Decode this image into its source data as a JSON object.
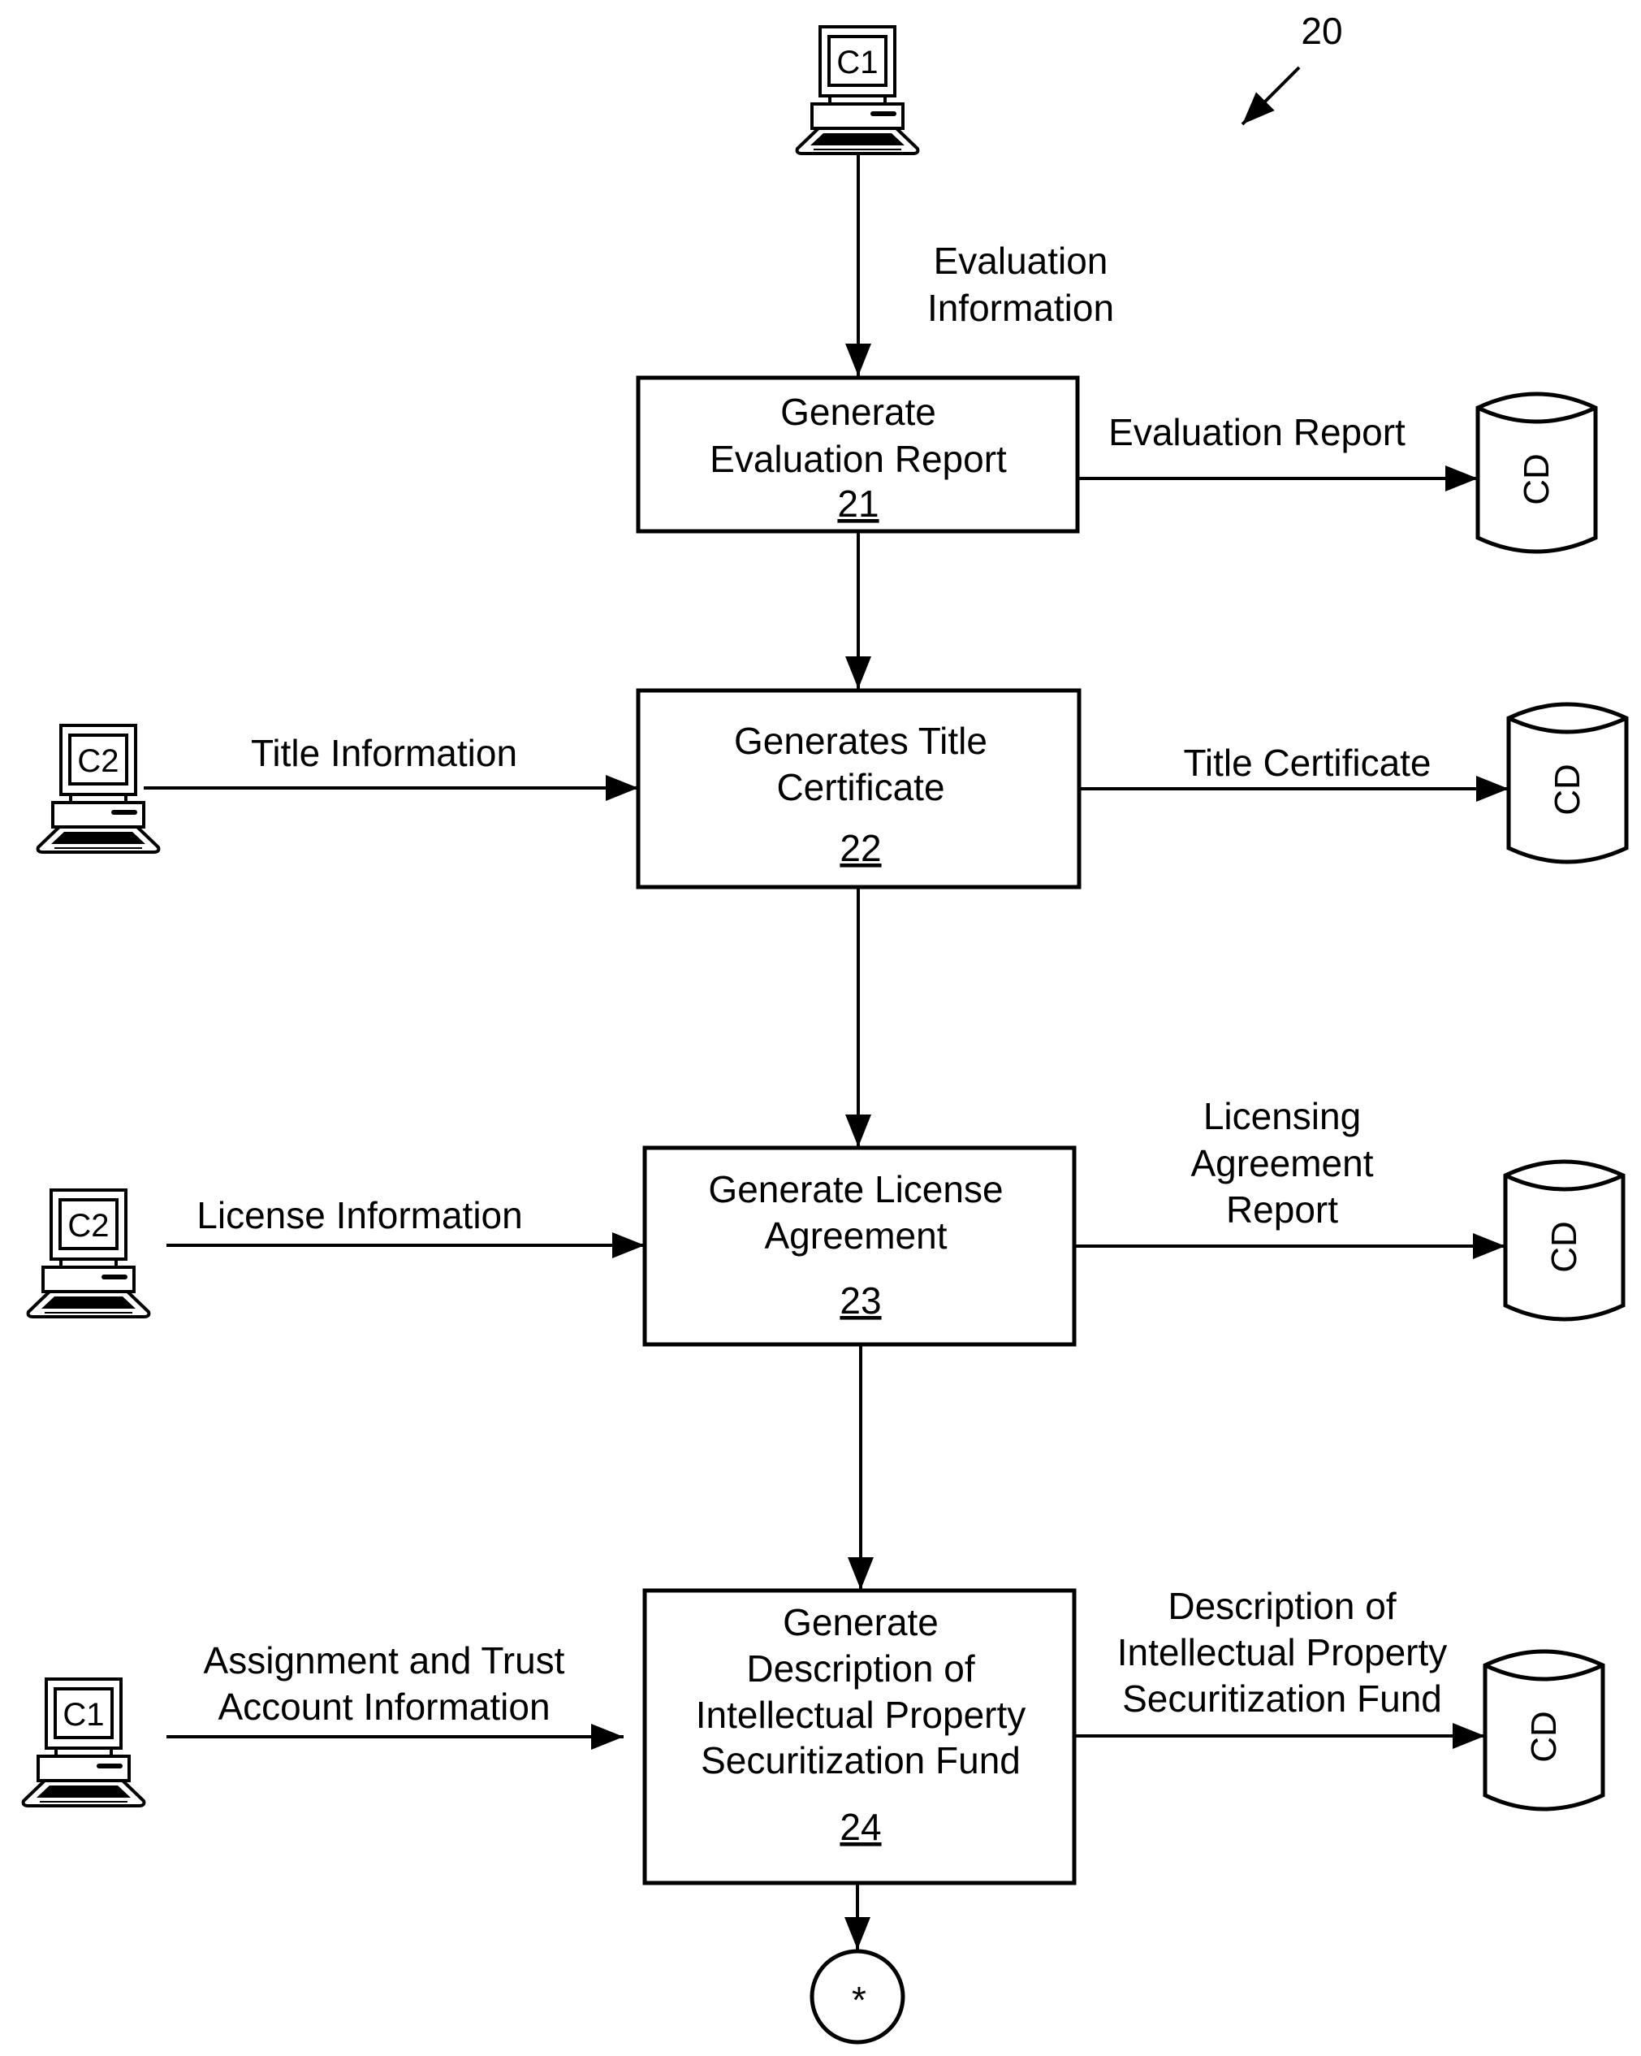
{
  "figure": {
    "reference_number": "20"
  },
  "top_terminal": {
    "label": "C1",
    "flow_label": [
      "Evaluation",
      "Information"
    ]
  },
  "steps": [
    {
      "id": "21",
      "lines": [
        "Generate",
        "Evaluation Report"
      ],
      "input": null,
      "output": {
        "label": [
          "Evaluation Report"
        ],
        "store": "CD"
      }
    },
    {
      "id": "22",
      "lines": [
        "Generates Title",
        "Certificate"
      ],
      "input": {
        "terminal": "C2",
        "label": [
          "Title Information"
        ]
      },
      "output": {
        "label": [
          "Title Certificate"
        ],
        "store": "CD"
      }
    },
    {
      "id": "23",
      "lines": [
        "Generate License",
        "Agreement"
      ],
      "input": {
        "terminal": "C2",
        "label": [
          "License Information"
        ]
      },
      "output": {
        "label": [
          "Licensing",
          "Agreement",
          "Report"
        ],
        "store": "CD"
      }
    },
    {
      "id": "24",
      "lines": [
        "Generate",
        "Description of",
        "Intellectual Property",
        "Securitization Fund"
      ],
      "input": {
        "terminal": "C1",
        "label": [
          "Assignment and Trust",
          "Account Information"
        ]
      },
      "output": {
        "label": [
          "Description of",
          "Intellectual Property",
          "Securitization Fund"
        ],
        "store": "CD"
      }
    }
  ],
  "connector": {
    "symbol": "*"
  }
}
